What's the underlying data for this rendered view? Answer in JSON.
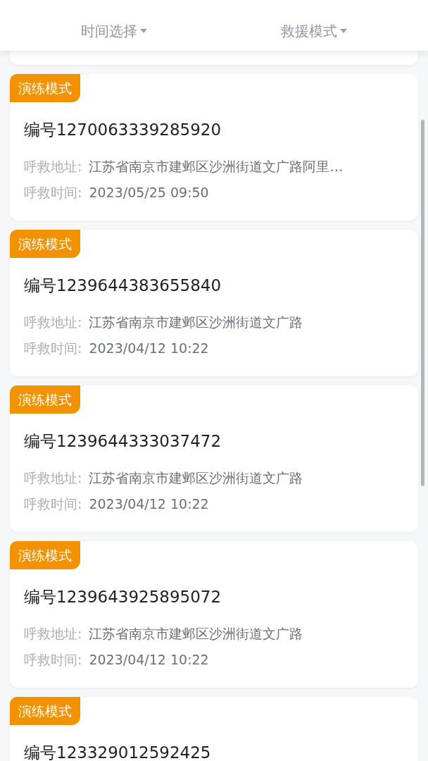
{
  "filters": [
    {
      "label": "时间选择"
    },
    {
      "label": "救援模式"
    }
  ],
  "cards": [
    {
      "tag": "演练模式",
      "number": "编号1270063339285920",
      "address_label": "呼救地址:",
      "address": "江苏省南京市建邺区沙洲街道文广路阿里…",
      "time_label": "呼救时间:",
      "time": "2023/05/25 09:50"
    },
    {
      "tag": "演练模式",
      "number": "编号1239644383655840",
      "address_label": "呼救地址:",
      "address": "江苏省南京市建邺区沙洲街道文广路",
      "time_label": "呼救时间:",
      "time": "2023/04/12 10:22"
    },
    {
      "tag": "演练模式",
      "number": "编号1239644333037472",
      "address_label": "呼救地址:",
      "address": "江苏省南京市建邺区沙洲街道文广路",
      "time_label": "呼救时间:",
      "time": "2023/04/12 10:22"
    },
    {
      "tag": "演练模式",
      "number": "编号1239643925895072",
      "address_label": "呼救地址:",
      "address": "江苏省南京市建邺区沙洲街道文广路",
      "time_label": "呼救时间:",
      "time": "2023/04/12 10:22"
    },
    {
      "tag": "演练模式",
      "number": "编号123329012592425"
    }
  ]
}
